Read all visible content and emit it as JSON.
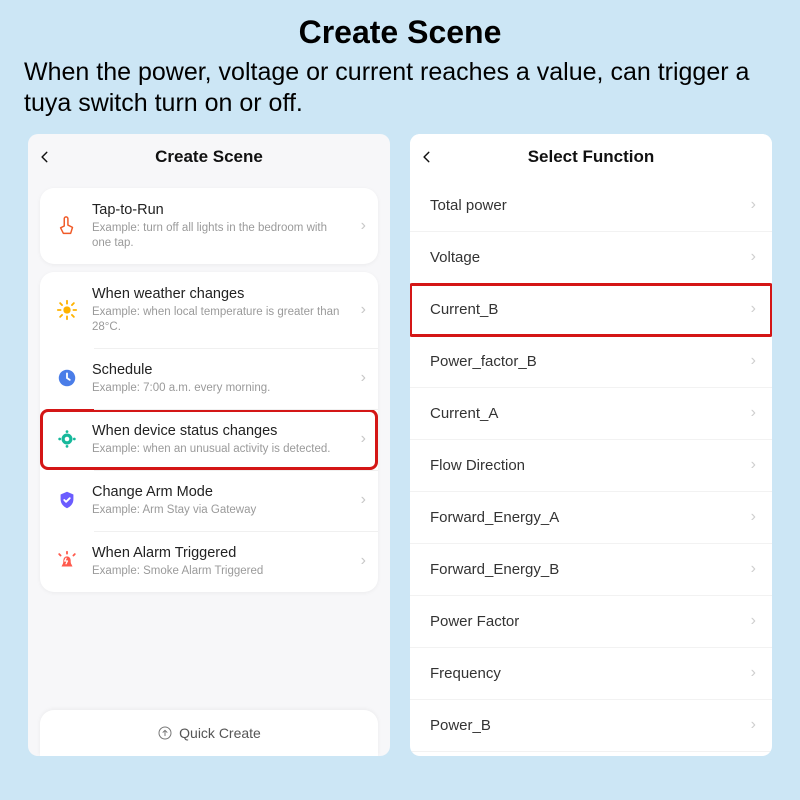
{
  "banner": {
    "title": "Create Scene",
    "subtitle": "When the power, voltage or current reaches a value, can trigger a tuya switch turn on or off."
  },
  "left": {
    "header_title": "Create Scene",
    "tap_to_run": {
      "title": "Tap-to-Run",
      "subtitle": "Example: turn off all lights in the bedroom with one tap."
    },
    "conditions": [
      {
        "icon": "sun",
        "title": "When weather changes",
        "subtitle": "Example: when local temperature is greater than 28°C."
      },
      {
        "icon": "clock",
        "title": "Schedule",
        "subtitle": "Example: 7:00 a.m. every morning."
      },
      {
        "icon": "device",
        "title": "When device status changes",
        "subtitle": "Example: when an unusual activity is detected.",
        "highlight": true
      },
      {
        "icon": "shield",
        "title": "Change Arm Mode",
        "subtitle": "Example: Arm Stay via Gateway"
      },
      {
        "icon": "alarm",
        "title": "When Alarm Triggered",
        "subtitle": "Example: Smoke Alarm Triggered"
      }
    ],
    "quick_create": "Quick Create"
  },
  "right": {
    "header_title": "Select Function",
    "functions": [
      {
        "label": "Total power"
      },
      {
        "label": "Voltage"
      },
      {
        "label": "Current_B",
        "highlight": true
      },
      {
        "label": "Power_factor_B"
      },
      {
        "label": "Current_A"
      },
      {
        "label": "Flow Direction"
      },
      {
        "label": "Forward_Energy_A"
      },
      {
        "label": "Forward_Energy_B"
      },
      {
        "label": "Power Factor"
      },
      {
        "label": "Frequency"
      },
      {
        "label": "Power_B"
      }
    ]
  }
}
